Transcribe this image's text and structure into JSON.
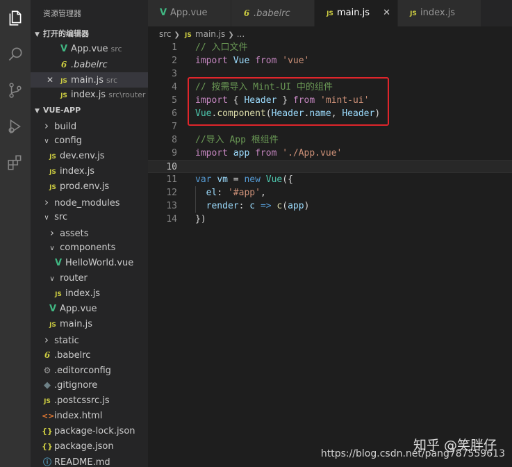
{
  "sidebar": {
    "title": "资源管理器",
    "open_editors_header": "打开的编辑器",
    "open_editors": [
      {
        "name": "App.vue",
        "path": "src",
        "icon": "vue"
      },
      {
        "name": ".babelrc",
        "path": "",
        "icon": "babel"
      },
      {
        "name": "main.js",
        "path": "src",
        "icon": "js"
      },
      {
        "name": "index.js",
        "path": "src\\router",
        "icon": "js"
      }
    ],
    "project_header": "VUE-APP",
    "tree": [
      {
        "name": "build",
        "type": "folder-closed"
      },
      {
        "name": "config",
        "type": "folder-open"
      },
      {
        "name": "dev.env.js",
        "type": "js"
      },
      {
        "name": "index.js",
        "type": "js"
      },
      {
        "name": "prod.env.js",
        "type": "js"
      },
      {
        "name": "node_modules",
        "type": "folder-closed"
      },
      {
        "name": "src",
        "type": "folder-open"
      },
      {
        "name": "assets",
        "type": "folder-closed"
      },
      {
        "name": "components",
        "type": "folder-open"
      },
      {
        "name": "HelloWorld.vue",
        "type": "vue"
      },
      {
        "name": "router",
        "type": "folder-open"
      },
      {
        "name": "index.js",
        "type": "js"
      },
      {
        "name": "App.vue",
        "type": "vue"
      },
      {
        "name": "main.js",
        "type": "js"
      },
      {
        "name": "static",
        "type": "folder-closed"
      },
      {
        "name": ".babelrc",
        "type": "babel"
      },
      {
        "name": ".editorconfig",
        "type": "gear"
      },
      {
        "name": ".gitignore",
        "type": "dot"
      },
      {
        "name": ".postcssrc.js",
        "type": "js"
      },
      {
        "name": "index.html",
        "type": "html"
      },
      {
        "name": "package-lock.json",
        "type": "json"
      },
      {
        "name": "package.json",
        "type": "json"
      },
      {
        "name": "README.md",
        "type": "info"
      }
    ]
  },
  "tabs": [
    {
      "label": "App.vue",
      "icon": "vue"
    },
    {
      "label": ".babelrc",
      "icon": "babel"
    },
    {
      "label": "main.js",
      "icon": "js",
      "active": true
    },
    {
      "label": "index.js",
      "icon": "js"
    }
  ],
  "breadcrumb": {
    "folder": "src",
    "file": "main.js",
    "more": "..."
  },
  "code": {
    "lines": [
      {
        "n": "1",
        "tokens": [
          [
            "com",
            "// 入口文件"
          ]
        ]
      },
      {
        "n": "2",
        "tokens": [
          [
            "kw2",
            "import"
          ],
          [
            "pl",
            " "
          ],
          [
            "var",
            "Vue"
          ],
          [
            "pl",
            " "
          ],
          [
            "kw2",
            "from"
          ],
          [
            "pl",
            " "
          ],
          [
            "str",
            "'vue'"
          ]
        ]
      },
      {
        "n": "3",
        "tokens": []
      },
      {
        "n": "4",
        "tokens": [
          [
            "com",
            "// 按需导入 Mint-UI 中的组件"
          ]
        ]
      },
      {
        "n": "5",
        "tokens": [
          [
            "kw2",
            "import"
          ],
          [
            "pl",
            " { "
          ],
          [
            "var",
            "Header"
          ],
          [
            "pl",
            " } "
          ],
          [
            "kw2",
            "from"
          ],
          [
            "pl",
            " "
          ],
          [
            "str",
            "'mint-ui'"
          ]
        ]
      },
      {
        "n": "6",
        "tokens": [
          [
            "cls",
            "Vue"
          ],
          [
            "pl",
            "."
          ],
          [
            "fn",
            "component"
          ],
          [
            "pl",
            "("
          ],
          [
            "var",
            "Header"
          ],
          [
            "pl",
            "."
          ],
          [
            "var",
            "name"
          ],
          [
            "pl",
            ", "
          ],
          [
            "var",
            "Header"
          ],
          [
            "pl",
            ")"
          ]
        ]
      },
      {
        "n": "7",
        "tokens": []
      },
      {
        "n": "8",
        "tokens": [
          [
            "com",
            "//导入 App 根组件"
          ]
        ]
      },
      {
        "n": "9",
        "tokens": [
          [
            "kw2",
            "import"
          ],
          [
            "pl",
            " "
          ],
          [
            "var",
            "app"
          ],
          [
            "pl",
            " "
          ],
          [
            "kw2",
            "from"
          ],
          [
            "pl",
            " "
          ],
          [
            "str",
            "'./App.vue'"
          ]
        ]
      },
      {
        "n": "10",
        "tokens": [],
        "current": true
      },
      {
        "n": "11",
        "tokens": [
          [
            "kw",
            "var"
          ],
          [
            "pl",
            " "
          ],
          [
            "var",
            "vm"
          ],
          [
            "pl",
            " = "
          ],
          [
            "kw",
            "new"
          ],
          [
            "pl",
            " "
          ],
          [
            "cls",
            "Vue"
          ],
          [
            "pl",
            "({"
          ]
        ]
      },
      {
        "n": "12",
        "tokens": [
          [
            "pl",
            "  "
          ],
          [
            "var",
            "el"
          ],
          [
            "pl",
            ": "
          ],
          [
            "str",
            "'#app'"
          ],
          [
            "pl",
            ","
          ]
        ],
        "guide": true
      },
      {
        "n": "13",
        "tokens": [
          [
            "pl",
            "  "
          ],
          [
            "var",
            "render"
          ],
          [
            "pl",
            ": "
          ],
          [
            "var",
            "c"
          ],
          [
            "pl",
            " "
          ],
          [
            "kw",
            "=>"
          ],
          [
            "pl",
            " "
          ],
          [
            "fn",
            "c"
          ],
          [
            "pl",
            "("
          ],
          [
            "var",
            "app"
          ],
          [
            "pl",
            ")"
          ]
        ],
        "guide": true
      },
      {
        "n": "14",
        "tokens": [
          [
            "pl",
            "})"
          ]
        ]
      }
    ]
  },
  "watermark": {
    "brand": "知乎 @笑胖仔",
    "url": "https://blog.csdn.net/pang787559613"
  },
  "colors": {
    "highlight_box": "#e0252b",
    "vue": "#41b883",
    "js": "#cbcb41"
  }
}
